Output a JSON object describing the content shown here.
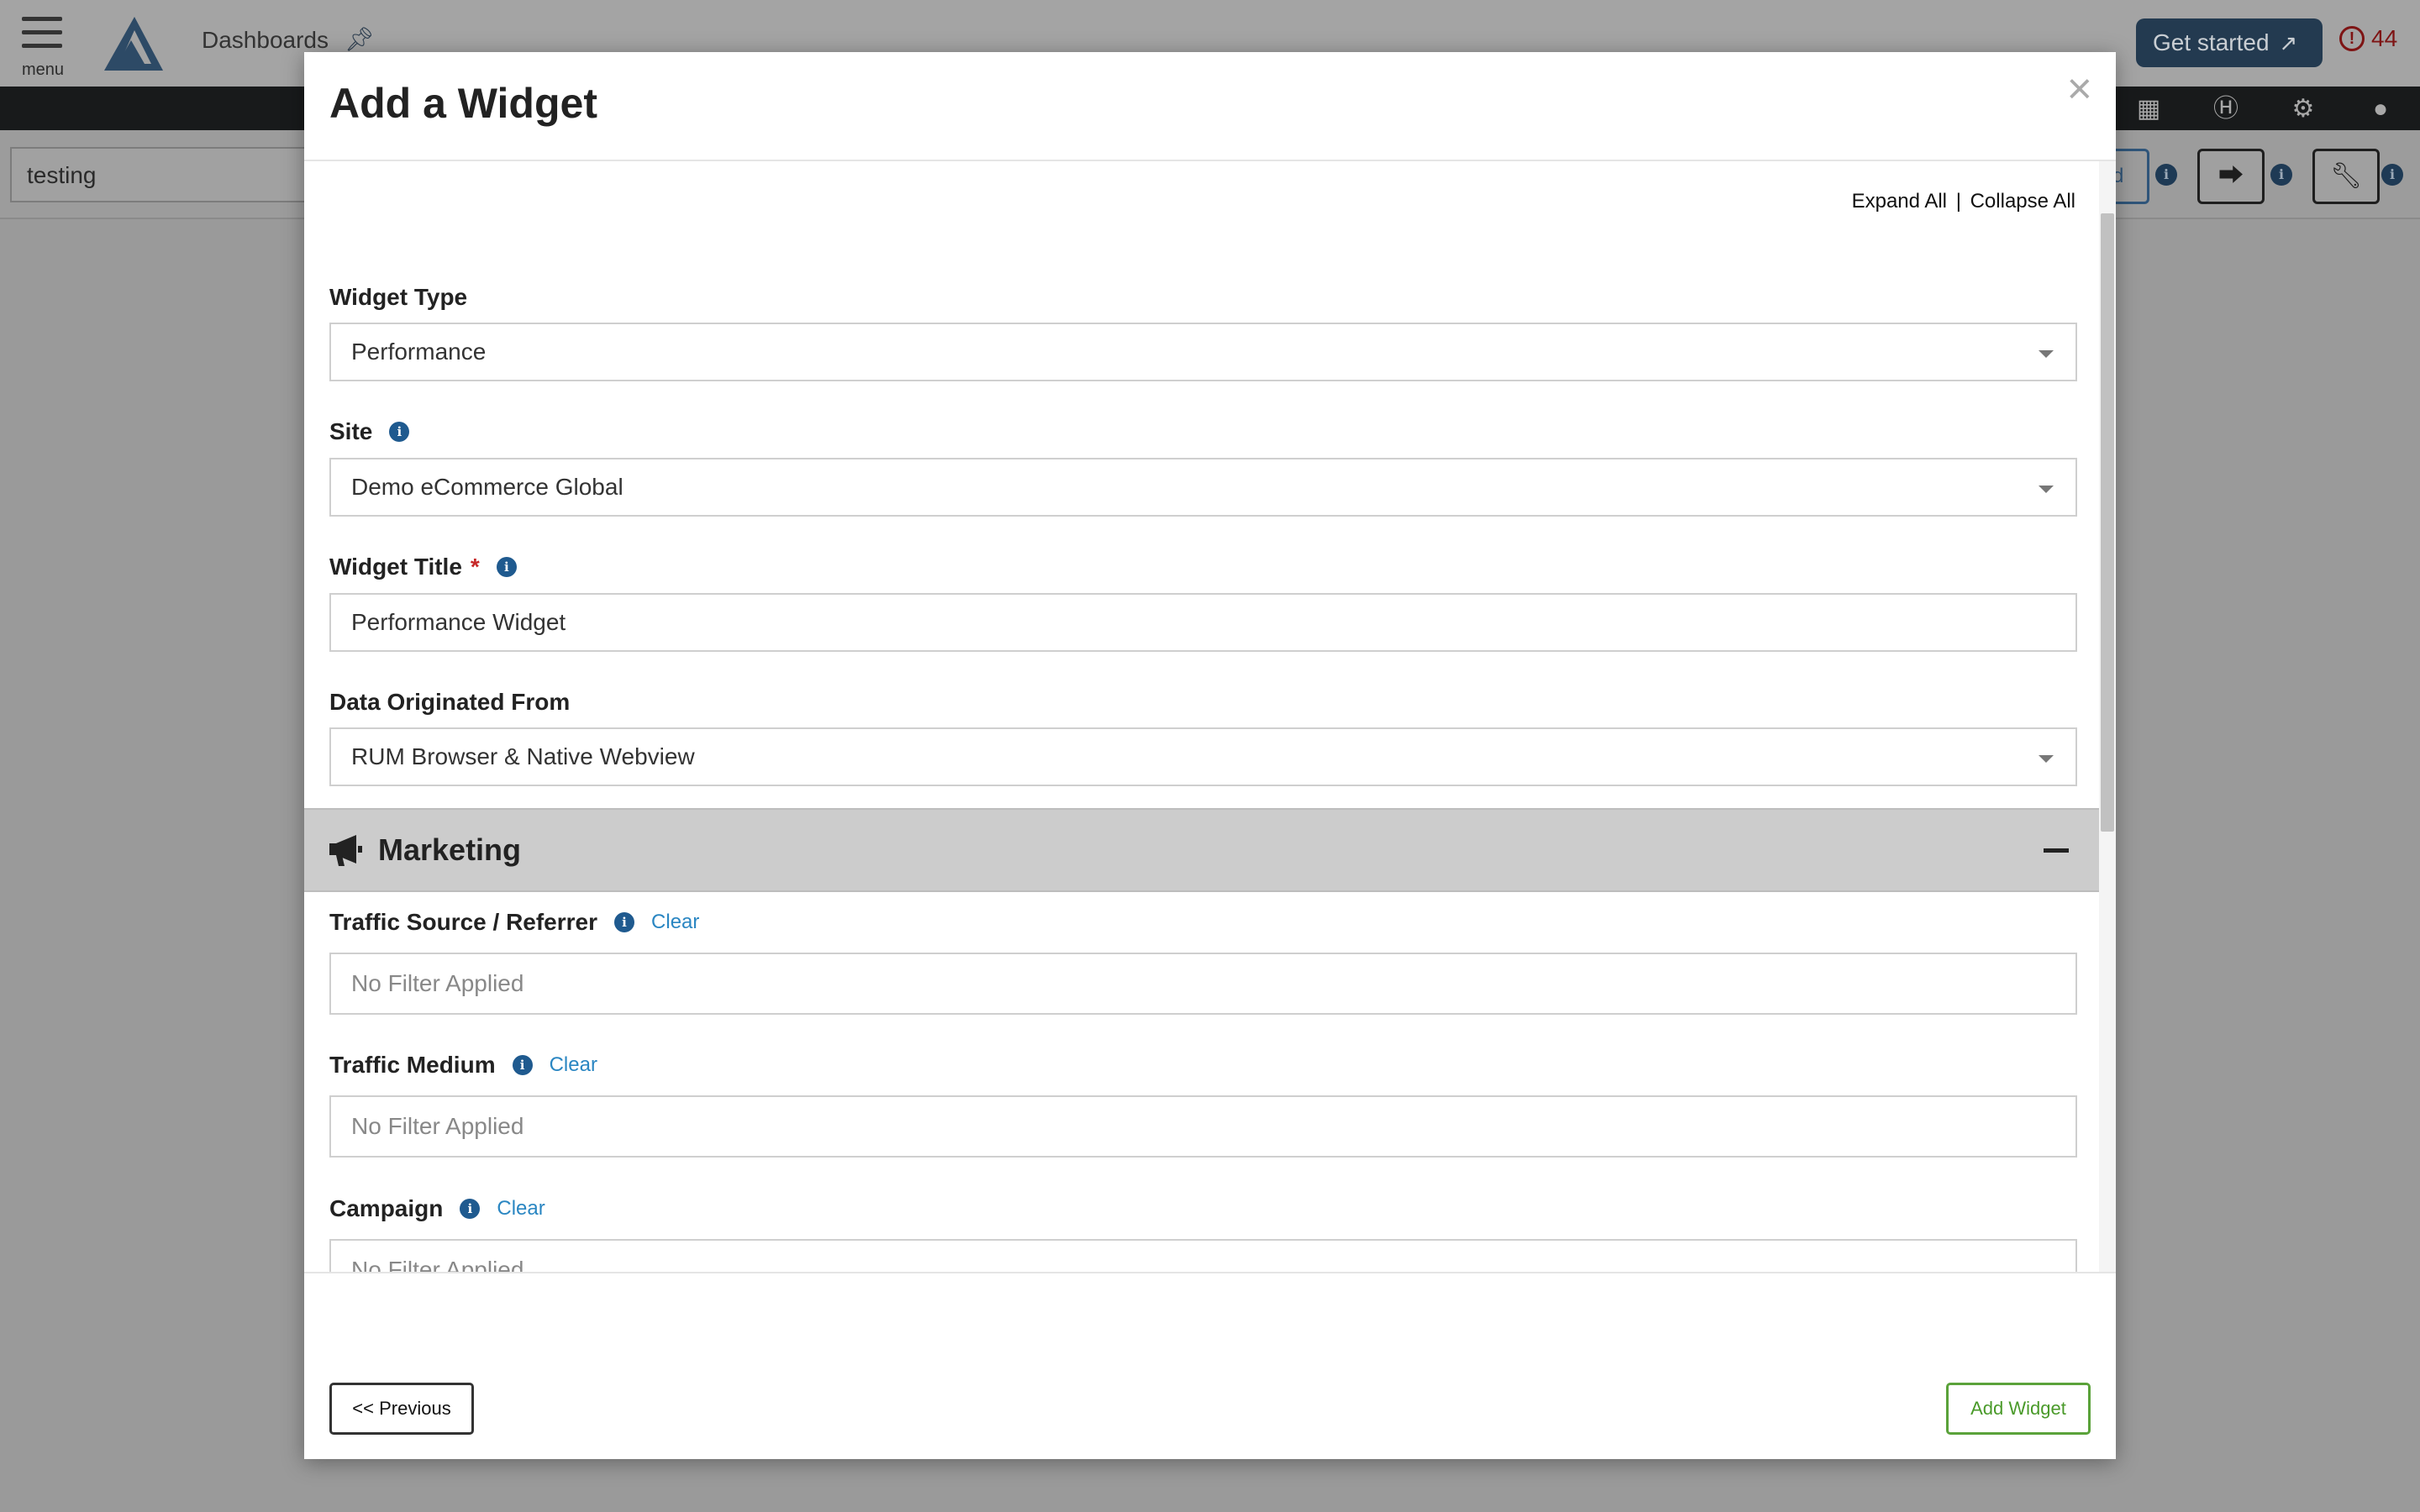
{
  "app": {
    "menu_label": "menu",
    "breadcrumb": "Dashboards",
    "get_started": "Get started",
    "alert_count": "44",
    "dashboard_name": "testing",
    "partial_button_text": "d"
  },
  "modal": {
    "title": "Add a Widget",
    "close_symbol": "×",
    "expand_all": "Expand All",
    "separator": "|",
    "collapse_all": "Collapse All",
    "widget_type": {
      "label": "Widget Type",
      "value": "Performance"
    },
    "site": {
      "label": "Site",
      "value": "Demo eCommerce Global"
    },
    "widget_title": {
      "label": "Widget Title",
      "required_mark": "*",
      "value": "Performance Widget"
    },
    "data_origin": {
      "label": "Data Originated From",
      "value": "RUM Browser & Native Webview"
    },
    "marketing": {
      "title": "Marketing",
      "traffic_source": {
        "label": "Traffic Source / Referrer",
        "clear": "Clear",
        "placeholder": "No Filter Applied"
      },
      "traffic_medium": {
        "label": "Traffic Medium",
        "clear": "Clear",
        "placeholder": "No Filter Applied"
      },
      "campaign": {
        "label": "Campaign",
        "clear": "Clear",
        "placeholder": "No Filter Applied"
      }
    },
    "prev_button": "<< Previous",
    "add_button": "Add Widget"
  },
  "colors": {
    "accent_green": "#5aa23a",
    "link_blue": "#2a86c2",
    "info_blue": "#1f5a8f",
    "required_red": "#c62828",
    "get_started_bg": "#233a50"
  }
}
